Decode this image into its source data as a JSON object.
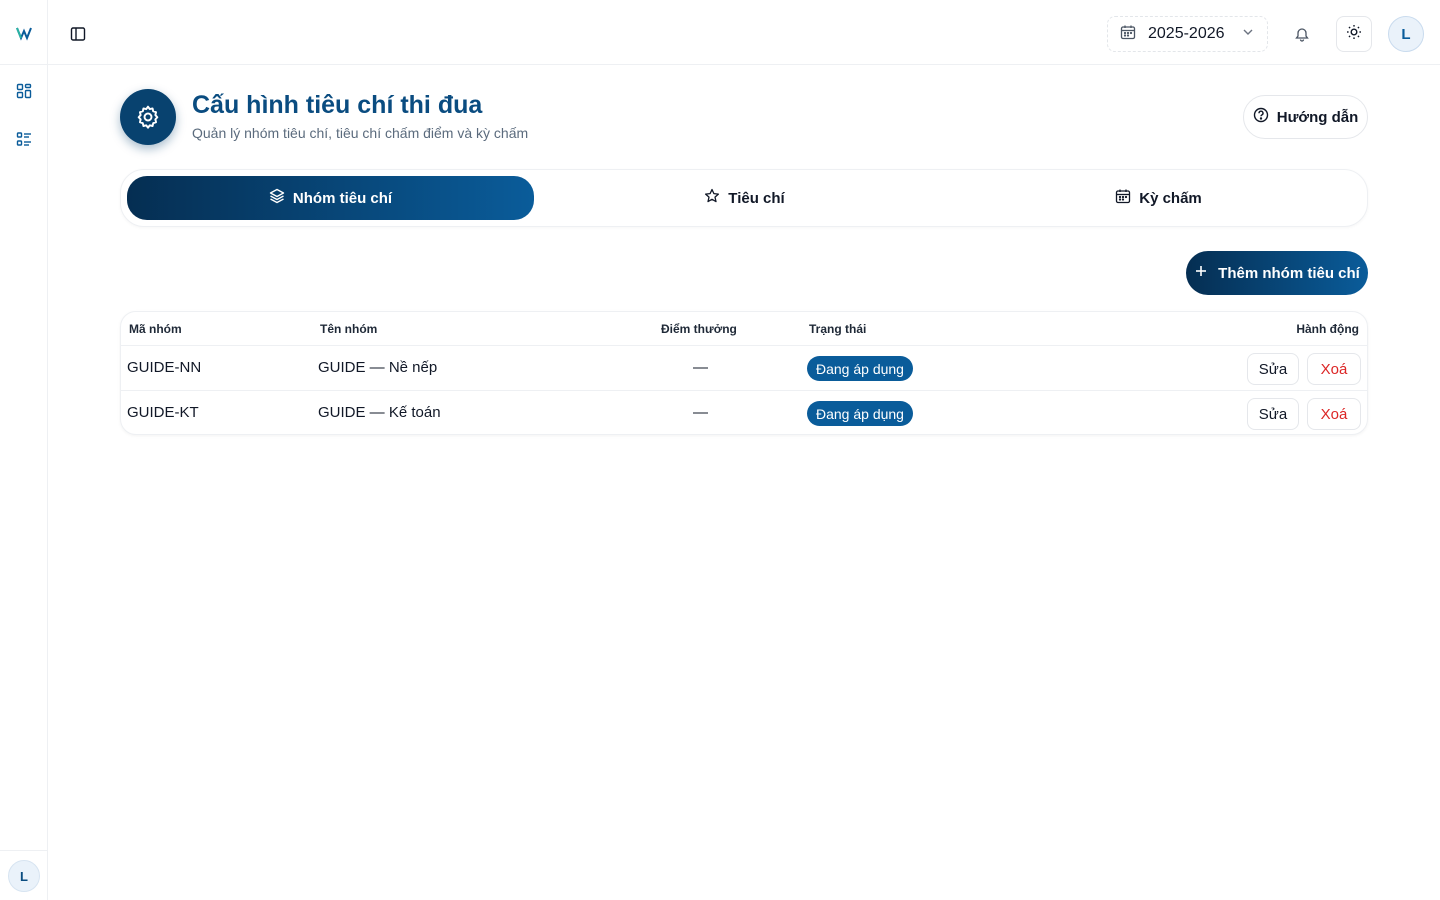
{
  "sidebar": {
    "user_initial": "L"
  },
  "topbar": {
    "year": "2025-2026",
    "user_initial": "L"
  },
  "header": {
    "title": "Cấu hình tiêu chí thi đua",
    "subtitle": "Quản lý nhóm tiêu chí, tiêu chí chấm điểm và kỳ chấm",
    "guide_label": "Hướng dẫn"
  },
  "tabs": [
    {
      "label": "Nhóm tiêu chí",
      "icon": "layers-icon",
      "active": true
    },
    {
      "label": "Tiêu chí",
      "icon": "star-icon",
      "active": false
    },
    {
      "label": "Kỳ chấm",
      "icon": "calendar-icon",
      "active": false
    }
  ],
  "add_button_label": "Thêm nhóm tiêu chí",
  "table": {
    "columns": [
      "Mã nhóm",
      "Tên nhóm",
      "Điểm thưởng",
      "Trạng thái",
      "Hành động"
    ],
    "rows": [
      {
        "code": "GUIDE-NN",
        "name": "GUIDE — Nề nếp",
        "bonus": "—",
        "status": "Đang áp dụng",
        "edit": "Sửa",
        "delete": "Xoá"
      },
      {
        "code": "GUIDE-KT",
        "name": "GUIDE — Kế toán",
        "bonus": "—",
        "status": "Đang áp dụng",
        "edit": "Sửa",
        "delete": "Xoá"
      }
    ]
  },
  "colors": {
    "brand": "#0a5c9a",
    "brand_dark": "#052e52",
    "danger": "#dc2626"
  }
}
